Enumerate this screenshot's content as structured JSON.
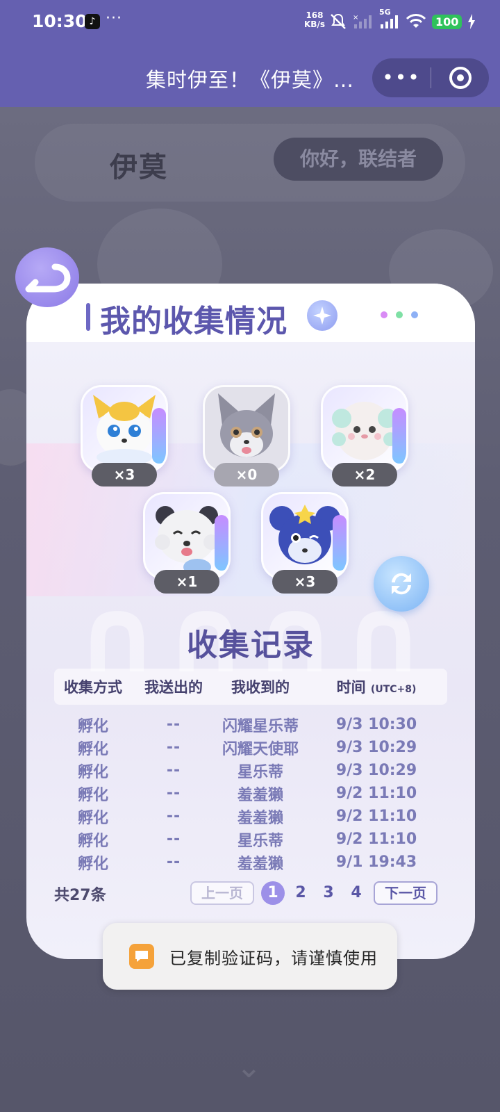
{
  "status_bar": {
    "time": "10:30",
    "extra_dots": "···",
    "net_speed_value": "168",
    "net_speed_unit": "KB/s",
    "signal_label": "5G",
    "battery": "100"
  },
  "nav": {
    "title": "集时伊至！《伊莫》…",
    "more_label": "•••"
  },
  "background_page": {
    "logo": "伊莫",
    "greeting": "你好，联结者"
  },
  "card": {
    "title": "我的收集情况",
    "dot_colors": [
      "#d98bf5",
      "#7fe0a5",
      "#8db0f5"
    ]
  },
  "collectibles": [
    {
      "count": "×3",
      "icon": "golden-fox-pet-icon",
      "color": "#f4c542"
    },
    {
      "count": "×0",
      "icon": "gray-wolf-pet-icon",
      "color": "#8e8e9e"
    },
    {
      "count": "×2",
      "icon": "fluffy-sheep-pet-icon",
      "color": "#bfe8df"
    },
    {
      "count": "×1",
      "icon": "white-panda-pet-icon",
      "color": "#f2f2f4"
    },
    {
      "count": "×3",
      "icon": "blue-mouse-pet-icon",
      "color": "#3c4fb8"
    }
  ],
  "records": {
    "title": "收集记录",
    "headers": {
      "method": "收集方式",
      "sent": "我送出的",
      "received": "我收到的",
      "time": "时间",
      "time_zone": "(UTC+8)"
    },
    "rows": [
      {
        "method": "孵化",
        "sent": "--",
        "received": "闪耀星乐蒂",
        "time": "9/3 10:30"
      },
      {
        "method": "孵化",
        "sent": "--",
        "received": "闪耀天使耶",
        "time": "9/3 10:29"
      },
      {
        "method": "孵化",
        "sent": "--",
        "received": "星乐蒂",
        "time": "9/3 10:29"
      },
      {
        "method": "孵化",
        "sent": "--",
        "received": "羞羞獭",
        "time": "9/2 11:10"
      },
      {
        "method": "孵化",
        "sent": "--",
        "received": "羞羞獭",
        "time": "9/2 11:10"
      },
      {
        "method": "孵化",
        "sent": "--",
        "received": "星乐蒂",
        "time": "9/2 11:10"
      },
      {
        "method": "孵化",
        "sent": "--",
        "received": "羞羞獭",
        "time": "9/1 19:43"
      }
    ],
    "total": "共27条",
    "pagination": {
      "prev": "上一页",
      "next": "下一页",
      "pages": [
        "1",
        "2",
        "3",
        "4"
      ],
      "current": "1"
    }
  },
  "toast": {
    "text": "已复制验证码，请谨慎使用"
  }
}
